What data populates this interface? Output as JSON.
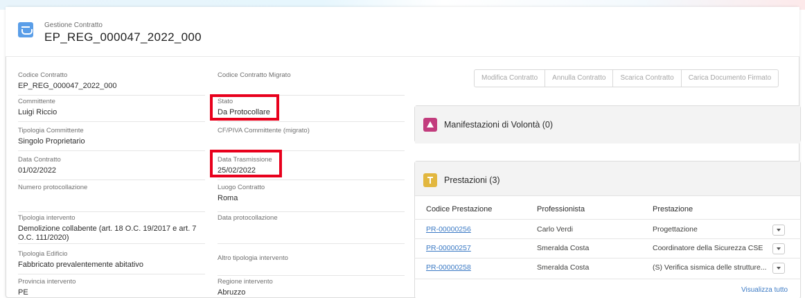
{
  "header": {
    "subtitle": "Gestione Contratto",
    "title": "EP_REG_000047_2022_000",
    "icon": "contract-icon"
  },
  "left_fields": [
    {
      "label": "Codice Contratto",
      "value": "EP_REG_000047_2022_000"
    },
    {
      "label": "Committente",
      "value": "Luigi Riccio"
    },
    {
      "label": "Tipologia Committente",
      "value": "Singolo Proprietario"
    },
    {
      "label": "Data Contratto",
      "value": "01/02/2022"
    },
    {
      "label": "Numero protocollazione",
      "value": ""
    },
    {
      "label": "Tipologia intervento",
      "value": "Demolizione collabente (art. 18 O.C. 19/2017 e art. 7 O.C. 111/2020)"
    },
    {
      "label": "Tipologia Edificio",
      "value": "Fabbricato prevalentemente abitativo"
    },
    {
      "label": "Provincia intervento",
      "value": "PE"
    }
  ],
  "right_fields": [
    {
      "label": "Codice Contratto Migrato",
      "value": ""
    },
    {
      "label": "Stato",
      "value": "Da Protocollare"
    },
    {
      "label": "CF/PIVA Committente (migrato)",
      "value": ""
    },
    {
      "label": "Data Trasmissione",
      "value": "25/02/2022"
    },
    {
      "label": "Luogo Contratto",
      "value": "Roma"
    },
    {
      "label": "Data protocollazione",
      "value": ""
    },
    {
      "label": "Altro tipologia intervento",
      "value": ""
    },
    {
      "label": "Regione intervento",
      "value": "Abruzzo"
    }
  ],
  "actions": {
    "modifica": "Modifica Contratto",
    "annulla": "Annulla Contratto",
    "scarica": "Scarica Contratto",
    "carica": "Carica Documento Firmato"
  },
  "manifestazioni": {
    "title": "Manifestazioni di Volontà (0)",
    "icon": "triangle-icon",
    "color": "#c23c7d"
  },
  "prestazioni": {
    "title": "Prestazioni (3)",
    "icon": "pin-icon",
    "color": "#e2b73f",
    "columns": [
      "Codice Prestazione",
      "Professionista",
      "Prestazione"
    ],
    "rows": [
      {
        "codice": "PR-00000256",
        "professionista": "Carlo Verdi",
        "prestazione": "Progettazione"
      },
      {
        "codice": "PR-00000257",
        "professionista": "Smeralda Costa",
        "prestazione": "Coordinatore della Sicurezza CSE"
      },
      {
        "codice": "PR-00000258",
        "professionista": "Smeralda Costa",
        "prestazione": "(S) Verifica sismica delle strutture..."
      }
    ],
    "view_all": "Visualizza tutto"
  },
  "highlight_color": "#e8001c"
}
